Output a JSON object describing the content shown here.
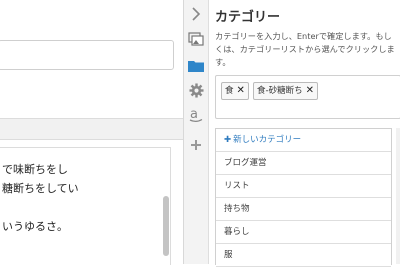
{
  "editor": {
    "body_lines": [
      "で味断ちをし",
      "糖断ちをしてい",
      "",
      "いうゆるさ。"
    ]
  },
  "rail": {
    "icons": [
      "chevron-right-icon",
      "images-icon",
      "folder-icon",
      "gear-icon",
      "amazon-icon",
      "plus-icon"
    ]
  },
  "panel": {
    "title": "カテゴリー",
    "description": "カテゴリーを入力し、Enterで確定します。もしくは、カテゴリーリストから選んでクリックします。",
    "tags": [
      {
        "label": "食",
        "remove": "✕"
      },
      {
        "label": "食-砂糖断ち",
        "remove": "✕"
      }
    ],
    "new_category_label": "新しいカテゴリー",
    "categories": [
      "ブログ運営",
      "リスト",
      "持ち物",
      "暮らし",
      "服"
    ]
  },
  "colors": {
    "accent": "#2e7bbf",
    "folder": "#2f86c9"
  }
}
